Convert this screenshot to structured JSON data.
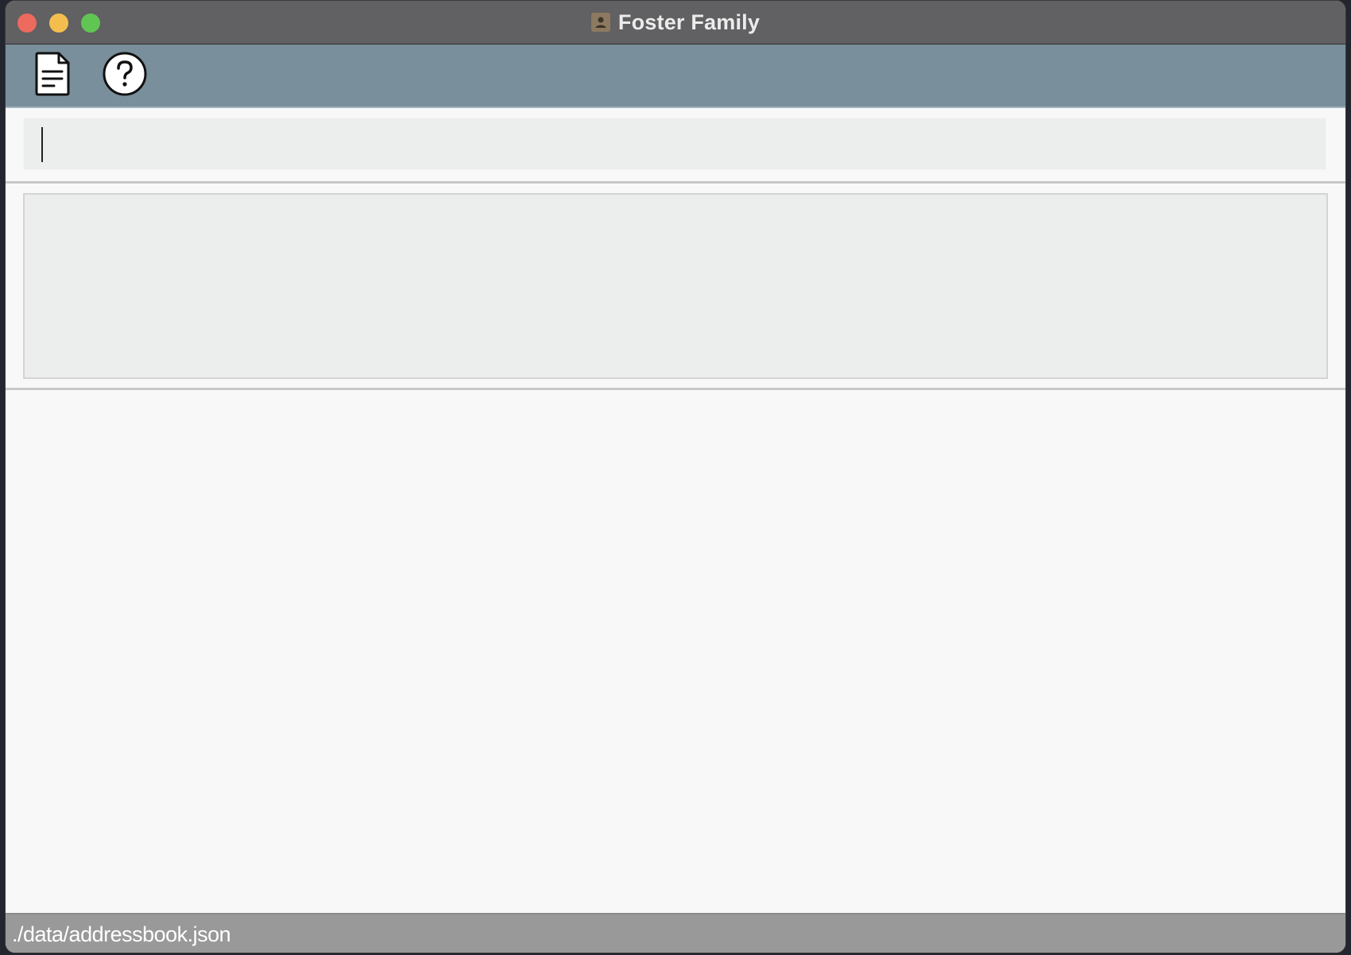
{
  "window": {
    "title": "Foster Family",
    "title_icon": "contacts-app-icon"
  },
  "toolbar": {
    "items": [
      {
        "name": "file-menu",
        "icon": "document-icon"
      },
      {
        "name": "help-menu",
        "icon": "help-circle-icon"
      }
    ]
  },
  "command": {
    "value": "",
    "placeholder": ""
  },
  "result": {
    "text": ""
  },
  "status": {
    "file_path": "./data/addressbook.json"
  },
  "colors": {
    "titlebar": "#616062",
    "toolbar": "#798f9b",
    "panel": "#eceeed",
    "statusbar": "#999999",
    "close": "#ed6a5e",
    "minimize": "#f4be4f",
    "maximize": "#61c554"
  }
}
